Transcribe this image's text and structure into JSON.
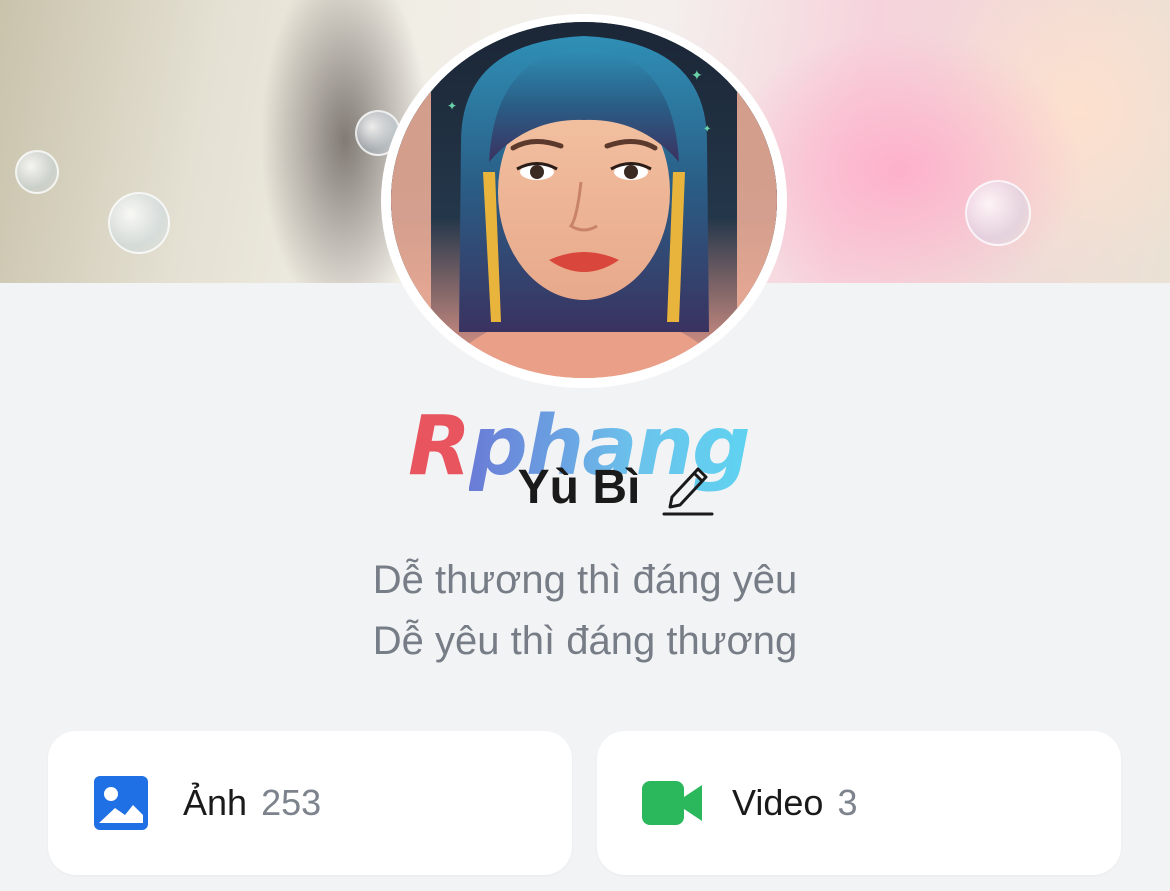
{
  "profile": {
    "name": "Yù Bì",
    "bio_line_1": "Dễ thương thì đáng yêu",
    "bio_line_2": "Dễ yêu thì đáng thương"
  },
  "watermark": {
    "first_letter": "R",
    "rest": "phang"
  },
  "media": {
    "photos": {
      "label": "Ảnh",
      "count": "253",
      "icon": "image-icon",
      "color": "#1f6fe5"
    },
    "videos": {
      "label": "Video",
      "count": "3",
      "icon": "video-camera-icon",
      "color": "#2bb85c"
    }
  },
  "colors": {
    "background": "#f2f3f5",
    "text": "#1a1a1a",
    "muted_text": "#777d86"
  }
}
